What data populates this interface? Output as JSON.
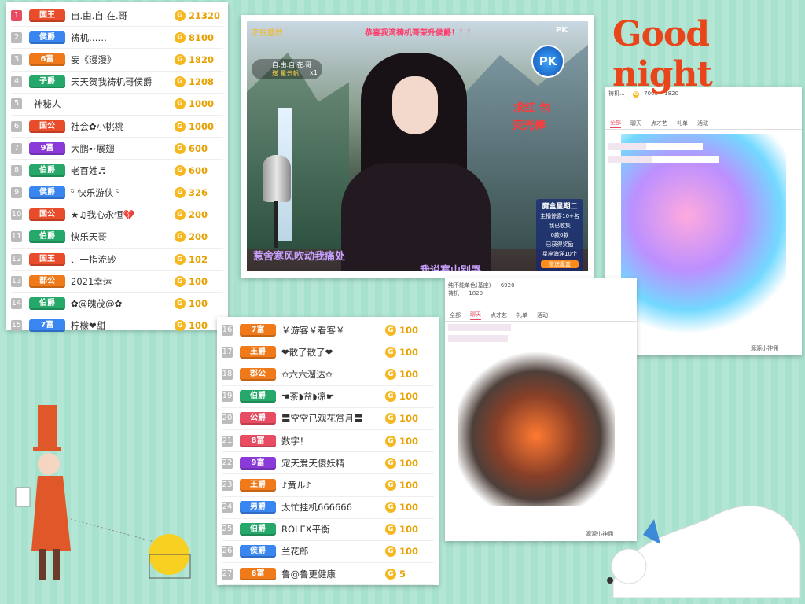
{
  "leaderboard_top": [
    {
      "rank": "1",
      "badge": "国王",
      "badge_color": "#e84c2a",
      "name": "自.由.自.在.哥",
      "amount": "21320"
    },
    {
      "rank": "2",
      "badge": "侯爵",
      "badge_color": "#3a86f0",
      "name": "祷机……",
      "amount": "8100"
    },
    {
      "rank": "3",
      "badge": "6富",
      "badge_color": "#f07a1a",
      "name": "妄《漫漫》",
      "amount": "1820"
    },
    {
      "rank": "4",
      "badge": "子爵",
      "badge_color": "#25a86a",
      "name": "天天贺我祷机哥侯爵",
      "amount": "1208"
    },
    {
      "rank": "5",
      "badge": "",
      "badge_color": "",
      "name": "神秘人",
      "amount": "1000"
    },
    {
      "rank": "6",
      "badge": "国公",
      "badge_color": "#e84c2a",
      "name": "社会✿小桃桃",
      "amount": "1000"
    },
    {
      "rank": "7",
      "badge": "9富",
      "badge_color": "#8a3ad8",
      "name": "大鹏➸展翅",
      "amount": "600"
    },
    {
      "rank": "8",
      "badge": "伯爵",
      "badge_color": "#25a86a",
      "name": "老百姓♬",
      "amount": "600"
    },
    {
      "rank": "9",
      "badge": "侯爵",
      "badge_color": "#3a86f0",
      "name": "ᵕ̈ 快乐游侠 ᵕ̈",
      "amount": "326"
    },
    {
      "rank": "10",
      "badge": "国公",
      "badge_color": "#e84c2a",
      "name": "★♫我心永恒💔",
      "amount": "200"
    },
    {
      "rank": "11",
      "badge": "伯爵",
      "badge_color": "#25a86a",
      "name": "快乐天哥",
      "amount": "200"
    },
    {
      "rank": "12",
      "badge": "国王",
      "badge_color": "#e84c2a",
      "name": "、一指流砂",
      "amount": "102"
    },
    {
      "rank": "13",
      "badge": "郡公",
      "badge_color": "#f07a1a",
      "name": "2021幸运",
      "amount": "100"
    },
    {
      "rank": "14",
      "badge": "伯爵",
      "badge_color": "#25a86a",
      "name": "✿@魄茂@✿",
      "amount": "100"
    },
    {
      "rank": "15",
      "badge": "7富",
      "badge_color": "#3a86f0",
      "name": "柠檬❤甜",
      "amount": "100"
    }
  ],
  "leaderboard_bottom": [
    {
      "rank": "16",
      "badge": "7富",
      "badge_color": "#f07a1a",
      "name": "￥游客￥看客￥",
      "amount": "100"
    },
    {
      "rank": "17",
      "badge": "王爵",
      "badge_color": "#f07a1a",
      "name": "❤散了散了❤",
      "amount": "100"
    },
    {
      "rank": "18",
      "badge": "郡公",
      "badge_color": "#f07a1a",
      "name": "✩六六溜达✩",
      "amount": "100"
    },
    {
      "rank": "19",
      "badge": "伯爵",
      "badge_color": "#25a86a",
      "name": "☚茶◗益◗凉☛",
      "amount": "100"
    },
    {
      "rank": "20",
      "badge": "公爵",
      "badge_color": "#e84c62",
      "name": "〓空空已观花赏月〓",
      "amount": "100"
    },
    {
      "rank": "21",
      "badge": "8富",
      "badge_color": "#e84c62",
      "name": "数字！",
      "amount": "100"
    },
    {
      "rank": "22",
      "badge": "9富",
      "badge_color": "#8a3ad8",
      "name": "宠天爱天傻妖精",
      "amount": "100"
    },
    {
      "rank": "23",
      "badge": "王爵",
      "badge_color": "#f07a1a",
      "name": "♪黄ル♪",
      "amount": "100"
    },
    {
      "rank": "24",
      "badge": "男爵",
      "badge_color": "#3a86f0",
      "name": "太忙挂机666666",
      "amount": "100"
    },
    {
      "rank": "25",
      "badge": "伯爵",
      "badge_color": "#25a86a",
      "name": "ROLEX平衡",
      "amount": "100"
    },
    {
      "rank": "26",
      "badge": "侯爵",
      "badge_color": "#3a86f0",
      "name": "兰花郎",
      "amount": "100"
    },
    {
      "rank": "27",
      "badge": "6富",
      "badge_color": "#f07a1a",
      "name": "鲁@鲁更健康",
      "amount": "5"
    }
  ],
  "video": {
    "banner": "恭喜我滴祷机哥荣升侯爵！！！",
    "status": "正在播放",
    "pk_label": "PK",
    "gift_user": "自.由.自.在.哥",
    "gift_text": "送 星云帆",
    "gift_count": "x1",
    "right_caption_1": "求红  包",
    "right_caption_2": "荧光棒",
    "lyric_1": "惹舍寒风吹动我痛处",
    "lyric_2": "我说寒山别哭",
    "box_title": "魔盒星期二",
    "box_l1": "主播惊喜10+名",
    "box_l2": "我已收集",
    "box_l3": "0款0款",
    "box_l4": "已获得奖励",
    "box_l5": "星座海洋10个",
    "box_btn": "赠送魔盒"
  },
  "chat_a": {
    "tabs": [
      "全部",
      "聊天",
      "点才艺",
      "礼单",
      "活动"
    ],
    "rows": [
      "祷机..."
    ],
    "amounts": [
      "7000",
      "1820"
    ],
    "footer": "源源小神佣"
  },
  "chat_b": {
    "tabs": [
      "全部",
      "聊天",
      "点才艺",
      "礼单",
      "活动"
    ],
    "rows": [
      "纯不能单色(基座)",
      "祷机"
    ],
    "amounts": [
      "6920",
      "1820"
    ],
    "footer": "源源小神佣"
  },
  "decor": {
    "good_night": "Good night"
  }
}
